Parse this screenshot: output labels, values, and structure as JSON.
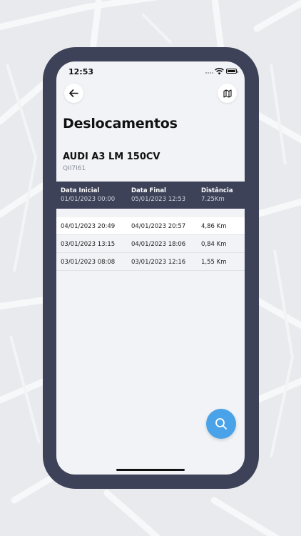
{
  "status_bar": {
    "time": "12:53"
  },
  "header": {
    "back_icon": "arrow-left-icon",
    "map_icon": "map-icon"
  },
  "page": {
    "title": "Deslocamentos"
  },
  "vehicle": {
    "name": "AUDI A3 LM 150CV",
    "plate": "QII7I61"
  },
  "summary": {
    "start_label": "Data Inicial",
    "start_value": "01/01/2023 00:00",
    "end_label": "Data Final",
    "end_value": "05/01/2023 12:53",
    "distance_label": "Distância",
    "distance_value": "7.25Km"
  },
  "trips": [
    {
      "start": "04/01/2023 20:49",
      "end": "04/01/2023 20:57",
      "distance": "4,86 Km"
    },
    {
      "start": "03/01/2023 13:15",
      "end": "04/01/2023 18:06",
      "distance": "0,84 Km"
    },
    {
      "start": "03/01/2023 08:08",
      "end": "03/01/2023 12:16",
      "distance": "1,55 Km"
    }
  ],
  "actions": {
    "search_icon": "search-icon"
  },
  "colors": {
    "accent": "#4aa3e8",
    "frame": "#3d4258",
    "screen_bg": "#f1f3f6"
  }
}
